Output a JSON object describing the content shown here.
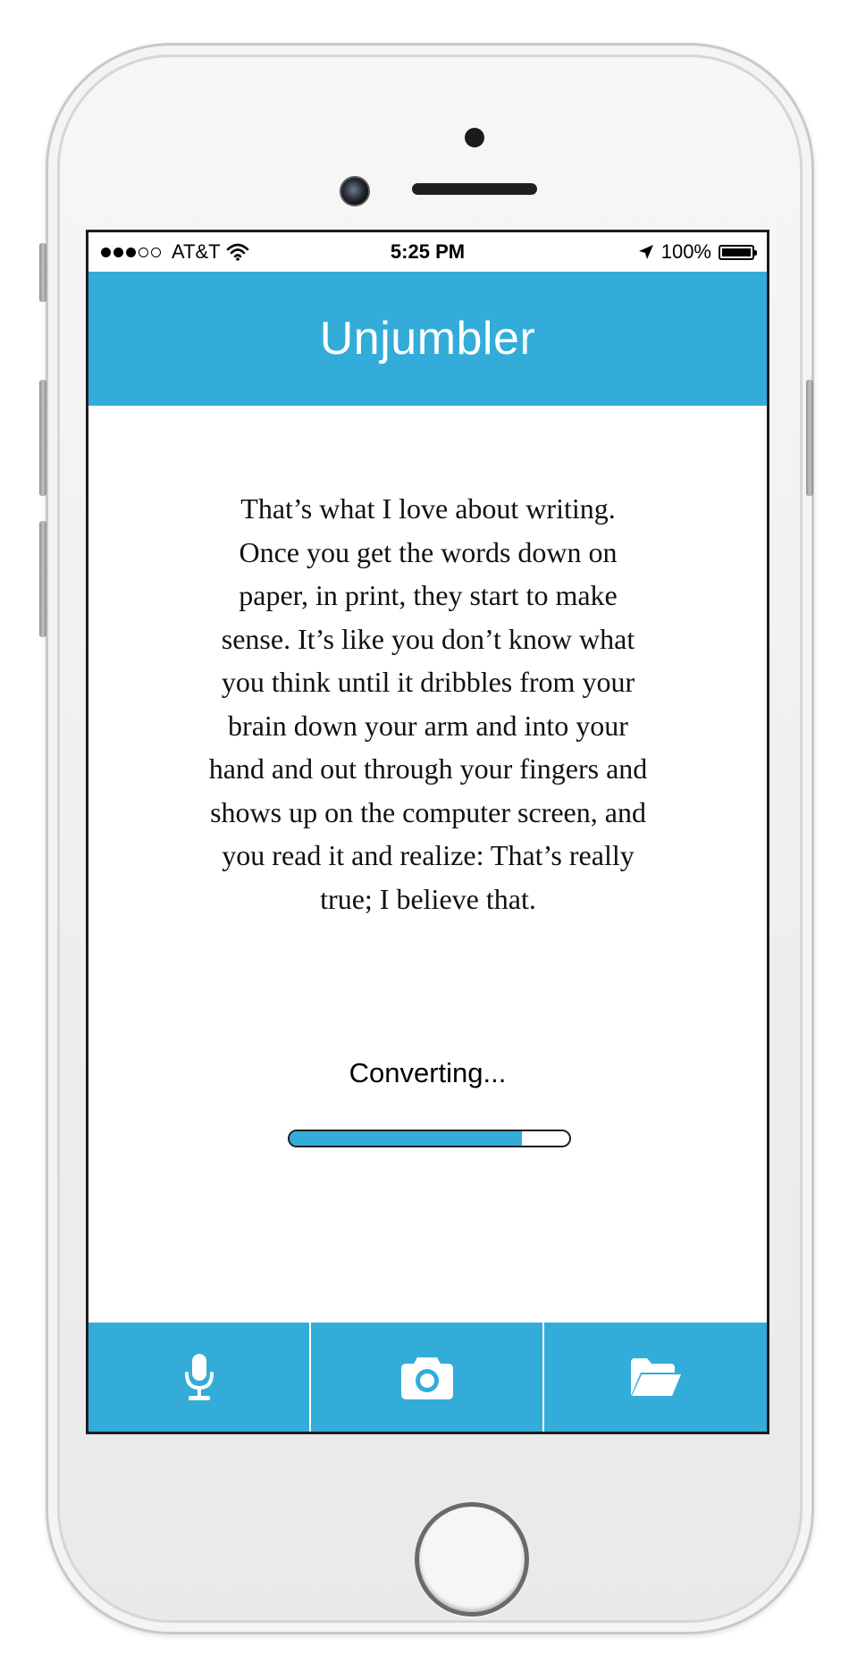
{
  "status_bar": {
    "carrier": "AT&T",
    "time": "5:25 PM",
    "battery": "100%",
    "signal_bars_filled": 3,
    "signal_bars_total": 5,
    "icons": [
      "wifi-icon",
      "location-arrow-icon",
      "battery-icon"
    ]
  },
  "header": {
    "title": "Unjumbler"
  },
  "content": {
    "quote_lines": [
      "That’s what I love about writing.",
      "Once you get the words down on",
      "paper, in print, they start to make",
      "sense. It’s like you don’t know what",
      "you think until it dribbles from your",
      "brain down your arm and into your",
      "hand and out through your fingers and",
      "shows up on the computer screen, and",
      "you read it and realize: That’s really",
      "true; I believe that."
    ]
  },
  "progress": {
    "label": "Converting...",
    "value_percent": 83
  },
  "tab_bar": {
    "items": [
      {
        "icon": "microphone-icon"
      },
      {
        "icon": "camera-icon"
      },
      {
        "icon": "folder-icon"
      }
    ]
  },
  "colors": {
    "accent": "#33acda",
    "text": "#111111",
    "background": "#ffffff"
  }
}
